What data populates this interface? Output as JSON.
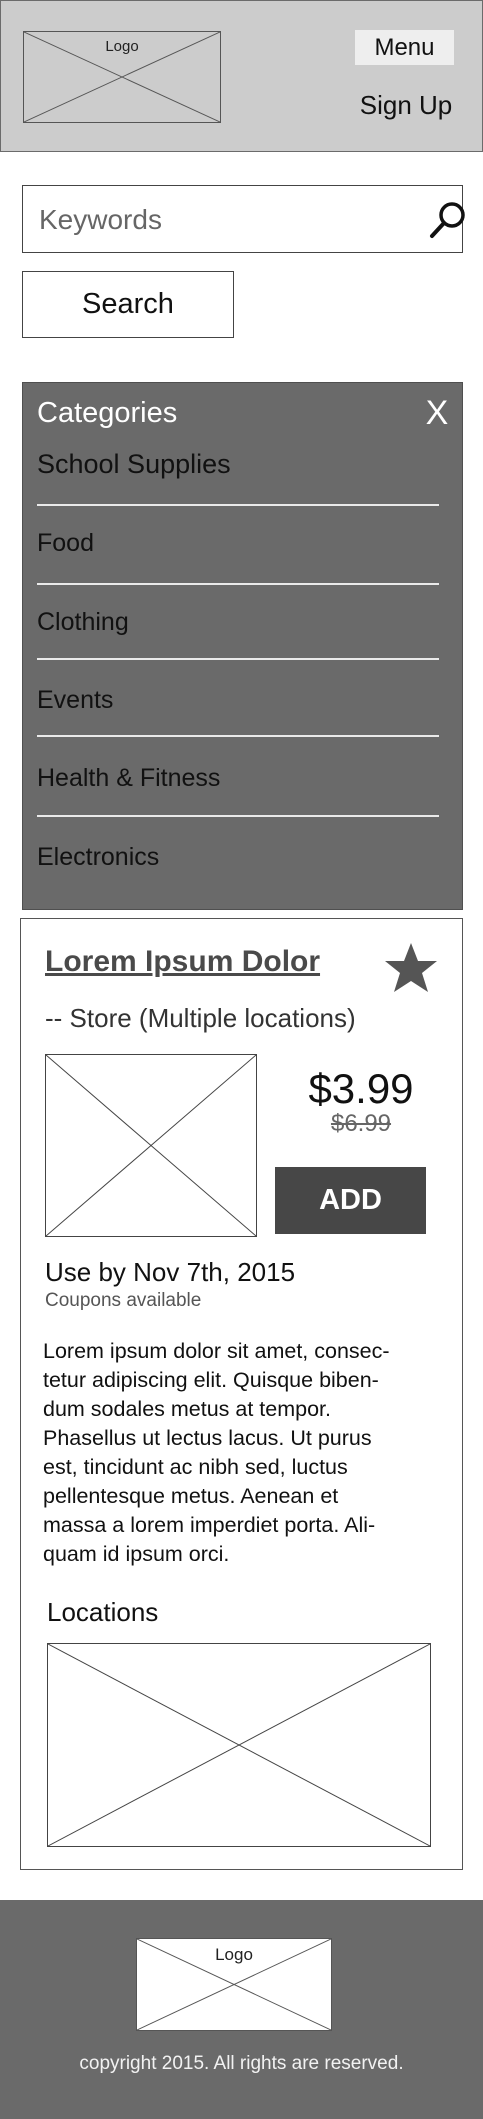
{
  "header": {
    "logo_label": "Logo",
    "menu_label": "Menu",
    "signup_label": "Sign Up"
  },
  "search": {
    "placeholder": "Keywords",
    "value": "",
    "button_label": "Search",
    "icon": "search-icon"
  },
  "categories": {
    "title": "Categories",
    "close_label": "X",
    "items": [
      {
        "label": "School Supplies"
      },
      {
        "label": "Food"
      },
      {
        "label": "Clothing"
      },
      {
        "label": "Events"
      },
      {
        "label": "Health & Fitness"
      },
      {
        "label": "Electronics"
      }
    ]
  },
  "coupon": {
    "title": "Lorem Ipsum Dolor",
    "favorite_icon": "star-icon",
    "store": "-- Store (Multiple locations)",
    "price": "$3.99",
    "old_price": "$6.99",
    "add_label": "ADD",
    "use_by": "Use by Nov 7th, 2015",
    "coupons_note": "Coupons available",
    "description": "Lorem ipsum dolor sit amet, consec-\ntetur adipiscing elit. Quisque biben-\ndum sodales metus at tempor.\nPhasellus ut lectus lacus. Ut purus\nest, tincidunt ac nibh sed, luctus\npellentesque metus. Aenean et\nmassa a lorem imperdiet porta. Ali-\nquam id ipsum orci.",
    "locations_label": "Locations"
  },
  "footer": {
    "logo_label": "Logo",
    "copyright": "copyright  2015. All rights are reserved."
  },
  "colors": {
    "header_bg": "#cccccc",
    "panel_bg": "#6a6a6a",
    "button_dark": "#474747",
    "star": "#555555"
  }
}
